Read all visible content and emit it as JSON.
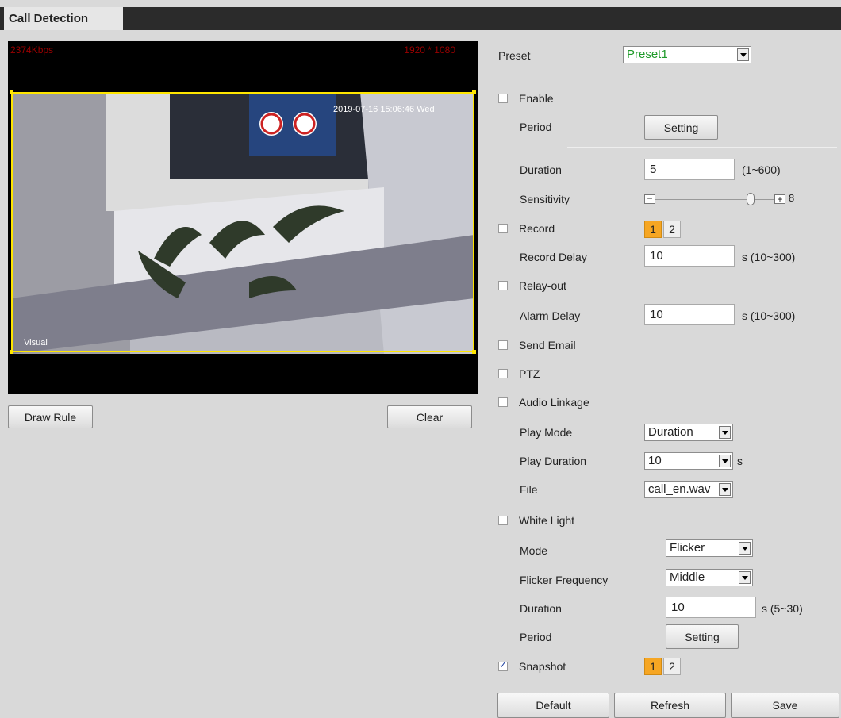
{
  "tab": {
    "title": "Call Detection"
  },
  "video": {
    "bitrate": "2374Kbps",
    "resolution": "1920 * 1080",
    "timestamp": "2019-07-16 15:06:46 Wed",
    "channel_label": "Visual"
  },
  "buttons": {
    "draw_rule": "Draw Rule",
    "clear": "Clear",
    "default": "Default",
    "refresh": "Refresh",
    "save": "Save"
  },
  "form": {
    "preset": {
      "label": "Preset",
      "value": "Preset1"
    },
    "enable": {
      "label": "Enable",
      "checked": false
    },
    "period": {
      "label": "Period",
      "button": "Setting"
    },
    "duration": {
      "label": "Duration",
      "value": "5",
      "range": "(1~600)"
    },
    "sensitivity": {
      "label": "Sensitivity",
      "value": "8",
      "level": 8,
      "max": 10
    },
    "record": {
      "label": "Record",
      "checked": false,
      "channels": [
        "1",
        "2"
      ]
    },
    "record_delay": {
      "label": "Record Delay",
      "value": "10",
      "range": "s (10~300)"
    },
    "relay_out": {
      "label": "Relay-out",
      "checked": false
    },
    "alarm_delay": {
      "label": "Alarm Delay",
      "value": "10",
      "range": "s (10~300)"
    },
    "send_email": {
      "label": "Send Email",
      "checked": false
    },
    "ptz": {
      "label": "PTZ",
      "checked": false
    },
    "audio_linkage": {
      "label": "Audio Linkage",
      "checked": false
    },
    "play_mode": {
      "label": "Play Mode",
      "value": "Duration"
    },
    "play_duration": {
      "label": "Play Duration",
      "value": "10",
      "unit": "s"
    },
    "file": {
      "label": "File",
      "value": "call_en.wav"
    },
    "white_light": {
      "label": "White Light",
      "checked": false
    },
    "mode": {
      "label": "Mode",
      "value": "Flicker"
    },
    "flicker_frequency": {
      "label": "Flicker Frequency",
      "value": "Middle"
    },
    "wl_duration": {
      "label": "Duration",
      "value": "10",
      "range": "s (5~30)"
    },
    "wl_period": {
      "label": "Period",
      "button": "Setting"
    },
    "snapshot": {
      "label": "Snapshot",
      "checked": true,
      "channels": [
        "1",
        "2"
      ]
    }
  },
  "colors": {
    "accent_orange": "#f6a623",
    "roi_yellow": "#ffe600",
    "preset_green": "#1f9a2a",
    "overlay_red": "#cc0000"
  }
}
